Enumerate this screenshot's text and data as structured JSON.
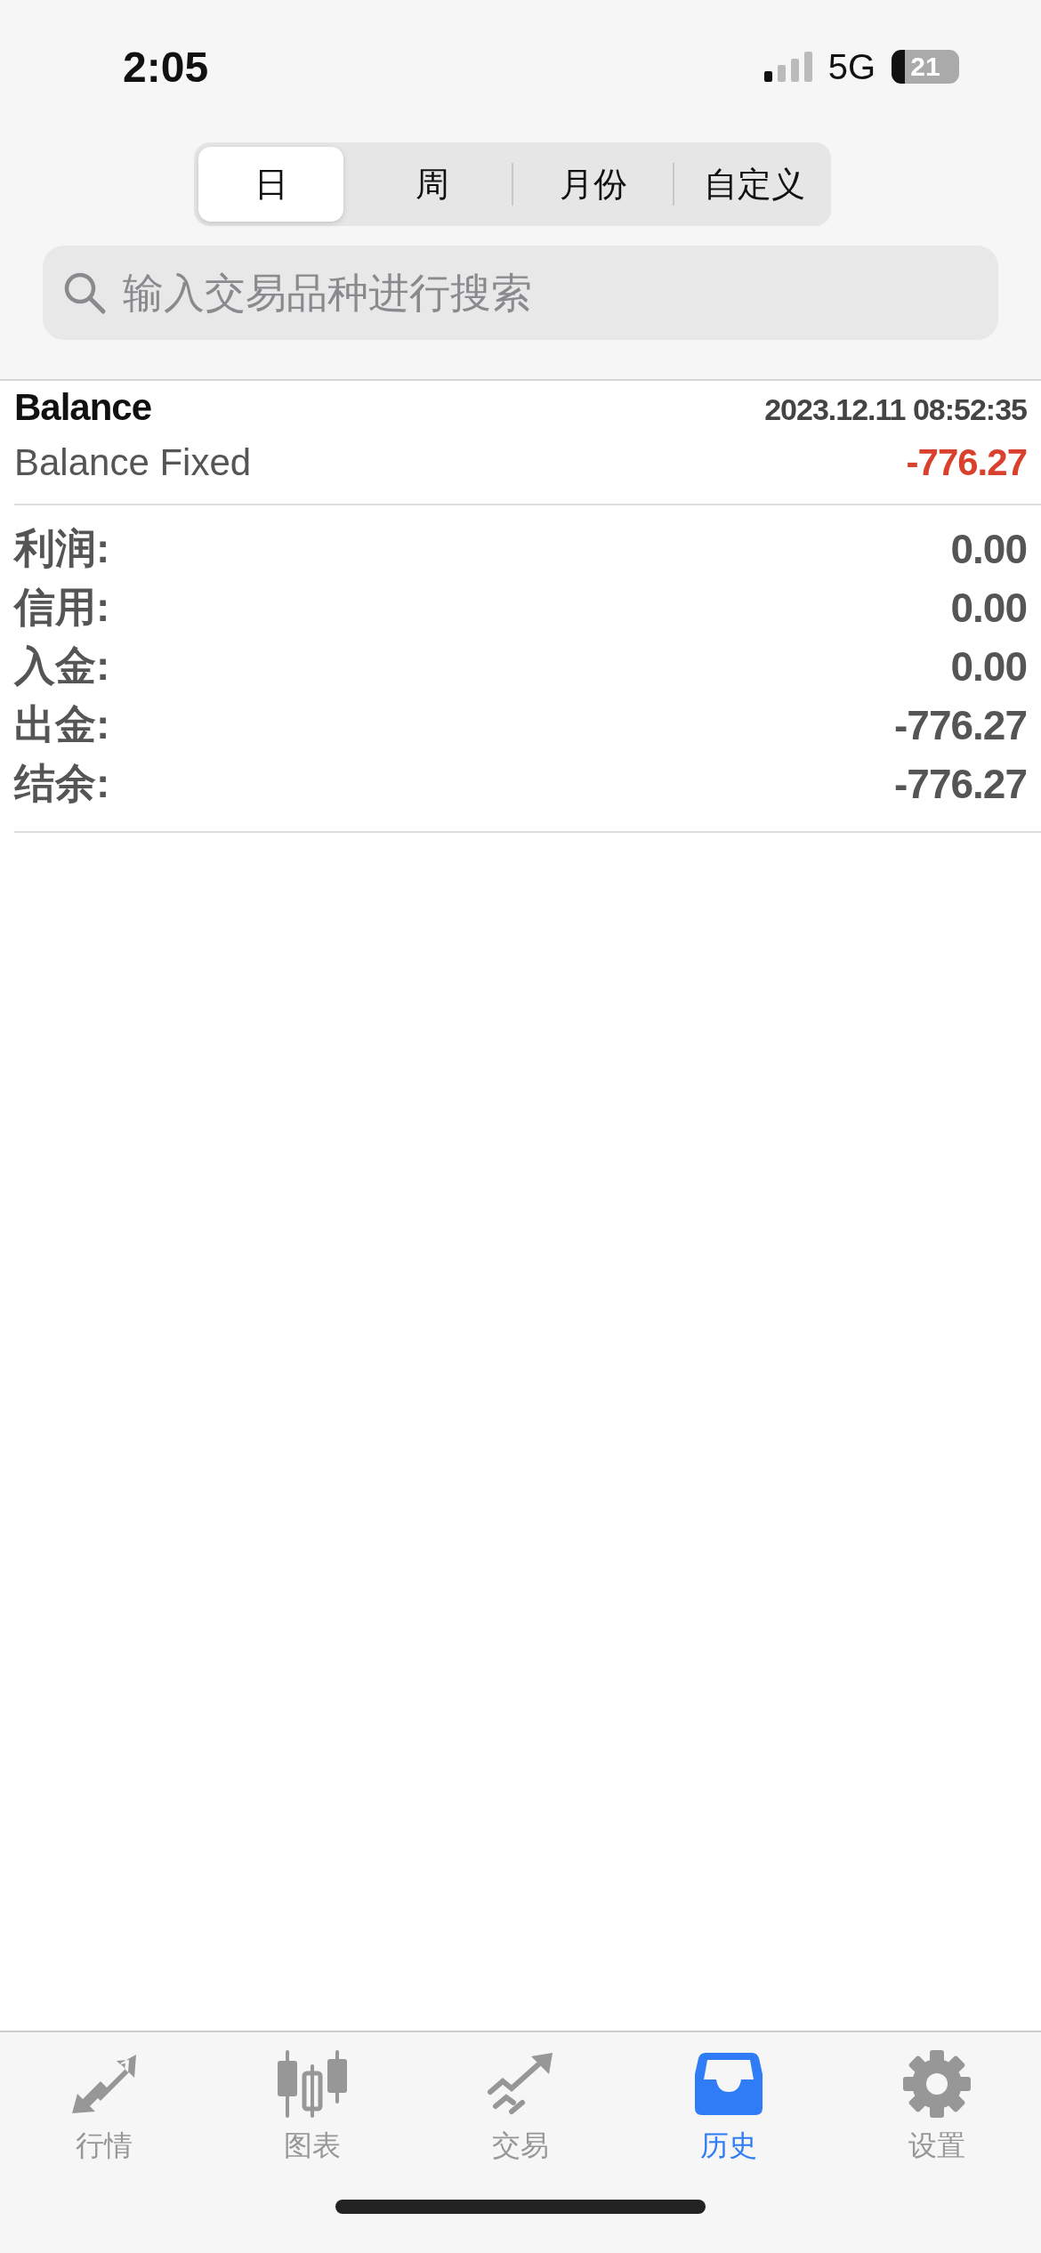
{
  "status_bar": {
    "time": "2:05",
    "network": "5G",
    "battery": "21"
  },
  "period_tabs": [
    {
      "label": "日",
      "selected": true
    },
    {
      "label": "周",
      "selected": false
    },
    {
      "label": "月份",
      "selected": false
    },
    {
      "label": "自定义",
      "selected": false
    }
  ],
  "search": {
    "placeholder": "输入交易品种进行搜索"
  },
  "deal": {
    "title": "Balance",
    "time": "2023.12.11 08:52:35",
    "comment": "Balance Fixed",
    "amount": "-776.27",
    "loss": true
  },
  "summary": [
    {
      "label": "利润:",
      "value": "0.00"
    },
    {
      "label": "信用:",
      "value": "0.00"
    },
    {
      "label": "入金:",
      "value": "0.00"
    },
    {
      "label": "出金:",
      "value": "-776.27"
    },
    {
      "label": "结余:",
      "value": "-776.27"
    }
  ],
  "nav": [
    {
      "kind": "quotes",
      "label": "行情",
      "selected": false
    },
    {
      "kind": "chart",
      "label": "图表",
      "selected": false
    },
    {
      "kind": "trade",
      "label": "交易",
      "selected": false
    },
    {
      "kind": "history",
      "label": "历史",
      "selected": true
    },
    {
      "kind": "settings",
      "label": "设置",
      "selected": false
    }
  ]
}
